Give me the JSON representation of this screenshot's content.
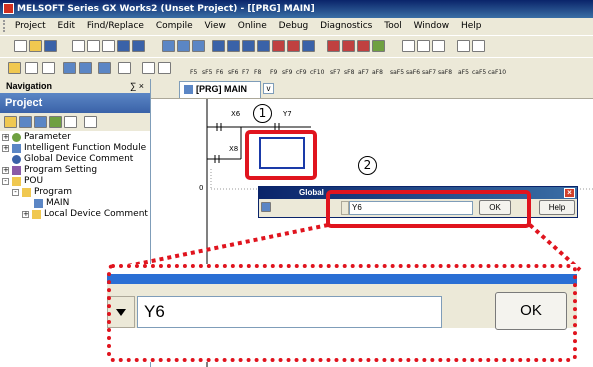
{
  "window": {
    "title": "MELSOFT Series GX Works2 (Unset Project) - [[PRG] MAIN]"
  },
  "menu": [
    "Project",
    "Edit",
    "Find/Replace",
    "Compile",
    "View",
    "Online",
    "Debug",
    "Diagnostics",
    "Tool",
    "Window",
    "Help"
  ],
  "toolbar2_labels": [
    "F5",
    "sF5",
    "F6",
    "sF6",
    "F7",
    "F8",
    "F9",
    "sF9",
    "cF9",
    "cF10",
    "sF7",
    "sF8",
    "aF7",
    "aF8",
    "saF5",
    "saF6",
    "saF7",
    "saF8",
    "aF5",
    "caF5",
    "caF10"
  ],
  "navigation": {
    "header": "Navigation",
    "pin_close": "∑ ×",
    "project_header": "Project",
    "tree": [
      {
        "label": "Parameter",
        "indent": 0,
        "expander": "+"
      },
      {
        "label": "Intelligent Function Module",
        "indent": 1,
        "expander": "+"
      },
      {
        "label": "Global Device Comment",
        "indent": 1,
        "expander": ""
      },
      {
        "label": "Program Setting",
        "indent": 0,
        "expander": "+"
      },
      {
        "label": "POU",
        "indent": 0,
        "expander": "-"
      },
      {
        "label": "Program",
        "indent": 1,
        "expander": "-"
      },
      {
        "label": "MAIN",
        "indent": 2,
        "expander": ""
      },
      {
        "label": "Local Device Comment",
        "indent": 1,
        "expander": "+"
      }
    ]
  },
  "editor": {
    "tab_label": "[PRG] MAIN",
    "contacts": [
      "X6",
      "Y7",
      "X8"
    ],
    "step_number": "0"
  },
  "dialog": {
    "title": "Global",
    "search_value": "Y6",
    "ok_label": "OK",
    "help_label": "Help"
  },
  "annotations": {
    "step1": "1",
    "step2": "2"
  },
  "zoom": {
    "search_value": "Y6",
    "ok_label": "OK"
  },
  "colors": {
    "highlight": "#e0141e",
    "titlebar": "#0a246a",
    "chrome": "#ece9d8"
  }
}
